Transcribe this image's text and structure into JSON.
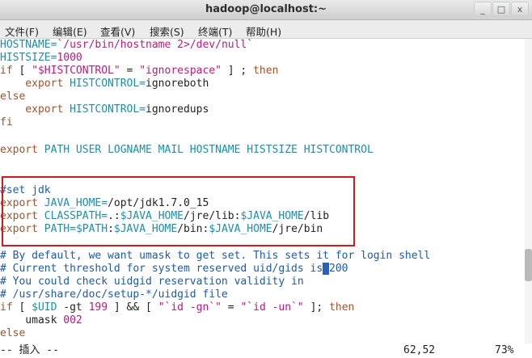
{
  "window": {
    "title": "hadoop@localhost:~",
    "buttons": [
      "_",
      "□",
      "x"
    ]
  },
  "menu": [
    {
      "label": "文件(F)"
    },
    {
      "label": "编辑(E)"
    },
    {
      "label": "查看(V)"
    },
    {
      "label": "搜索(S)"
    },
    {
      "label": "终端(T)"
    },
    {
      "label": "帮助(H)"
    }
  ],
  "lines": {
    "l1a": "HOSTNAME=",
    "l1b": "`/usr/bin/hostname 2>/dev/null`",
    "l2a": "HISTSIZE=",
    "l2b": "1000",
    "l3a": "if",
    "l3b": " [ ",
    "l3c": "\"$HISTCONTROL\"",
    "l3d": " = ",
    "l3e": "\"ignorespace\"",
    "l3f": " ] ; ",
    "l3g": "then",
    "l4a": "    export ",
    "l4b": "HISTCONTROL=",
    "l4c": "ignoreboth",
    "l5": "else",
    "l6a": "    export ",
    "l6b": "HISTCONTROL=",
    "l6c": "ignoredups",
    "l7": "fi",
    "l8a": "export ",
    "l8b": "PATH USER LOGNAME MAIL HOSTNAME HISTSIZE HISTCONTROL",
    "l9": "#set jdk",
    "l10a": "export ",
    "l10b": "JAVA_HOME=",
    "l10c": "/opt/jdk1.7.0_15",
    "l11a": "export ",
    "l11b": "CLASSPATH=",
    "l11c": ".:",
    "l11d": "$JAVA_HOME",
    "l11e": "/jre/lib:",
    "l11f": "$JAVA_HOME",
    "l11g": "/lib",
    "l12a": "export ",
    "l12b": "PATH=",
    "l12c": "$PATH",
    "l12d": ":",
    "l12e": "$JAVA_HOME",
    "l12f": "/bin:",
    "l12g": "$JAVA_HOME",
    "l12h": "/jre/bin",
    "l13": "# By default, we want umask to get set. This sets it for login shell",
    "l14a": "# Current threshold for system reserved uid/gids is",
    "l14b": " ",
    "l14c": "200",
    "l15": "# You could check uidgid reservation validity in",
    "l16": "# /usr/share/doc/setup-*/uidgid file",
    "l17a": "if",
    "l17b": " [ ",
    "l17c": "$UID",
    "l17d": " -gt ",
    "l17e": "199",
    "l17f": " ] && [ ",
    "l17g": "\"`id -gn`\"",
    "l17h": " = ",
    "l17i": "\"`id -un`\"",
    "l17j": " ]; ",
    "l17k": "then",
    "l18a": "    umask ",
    "l18b": "002",
    "l19": "else"
  },
  "status": {
    "mode": "-- 插入 --",
    "position": "62,52",
    "percent": "73%"
  },
  "colors": {
    "annotation_box": "#d11a1a",
    "comment": "#1e5aa8",
    "string": "#c0187c",
    "variable": "#1a8fa8"
  }
}
